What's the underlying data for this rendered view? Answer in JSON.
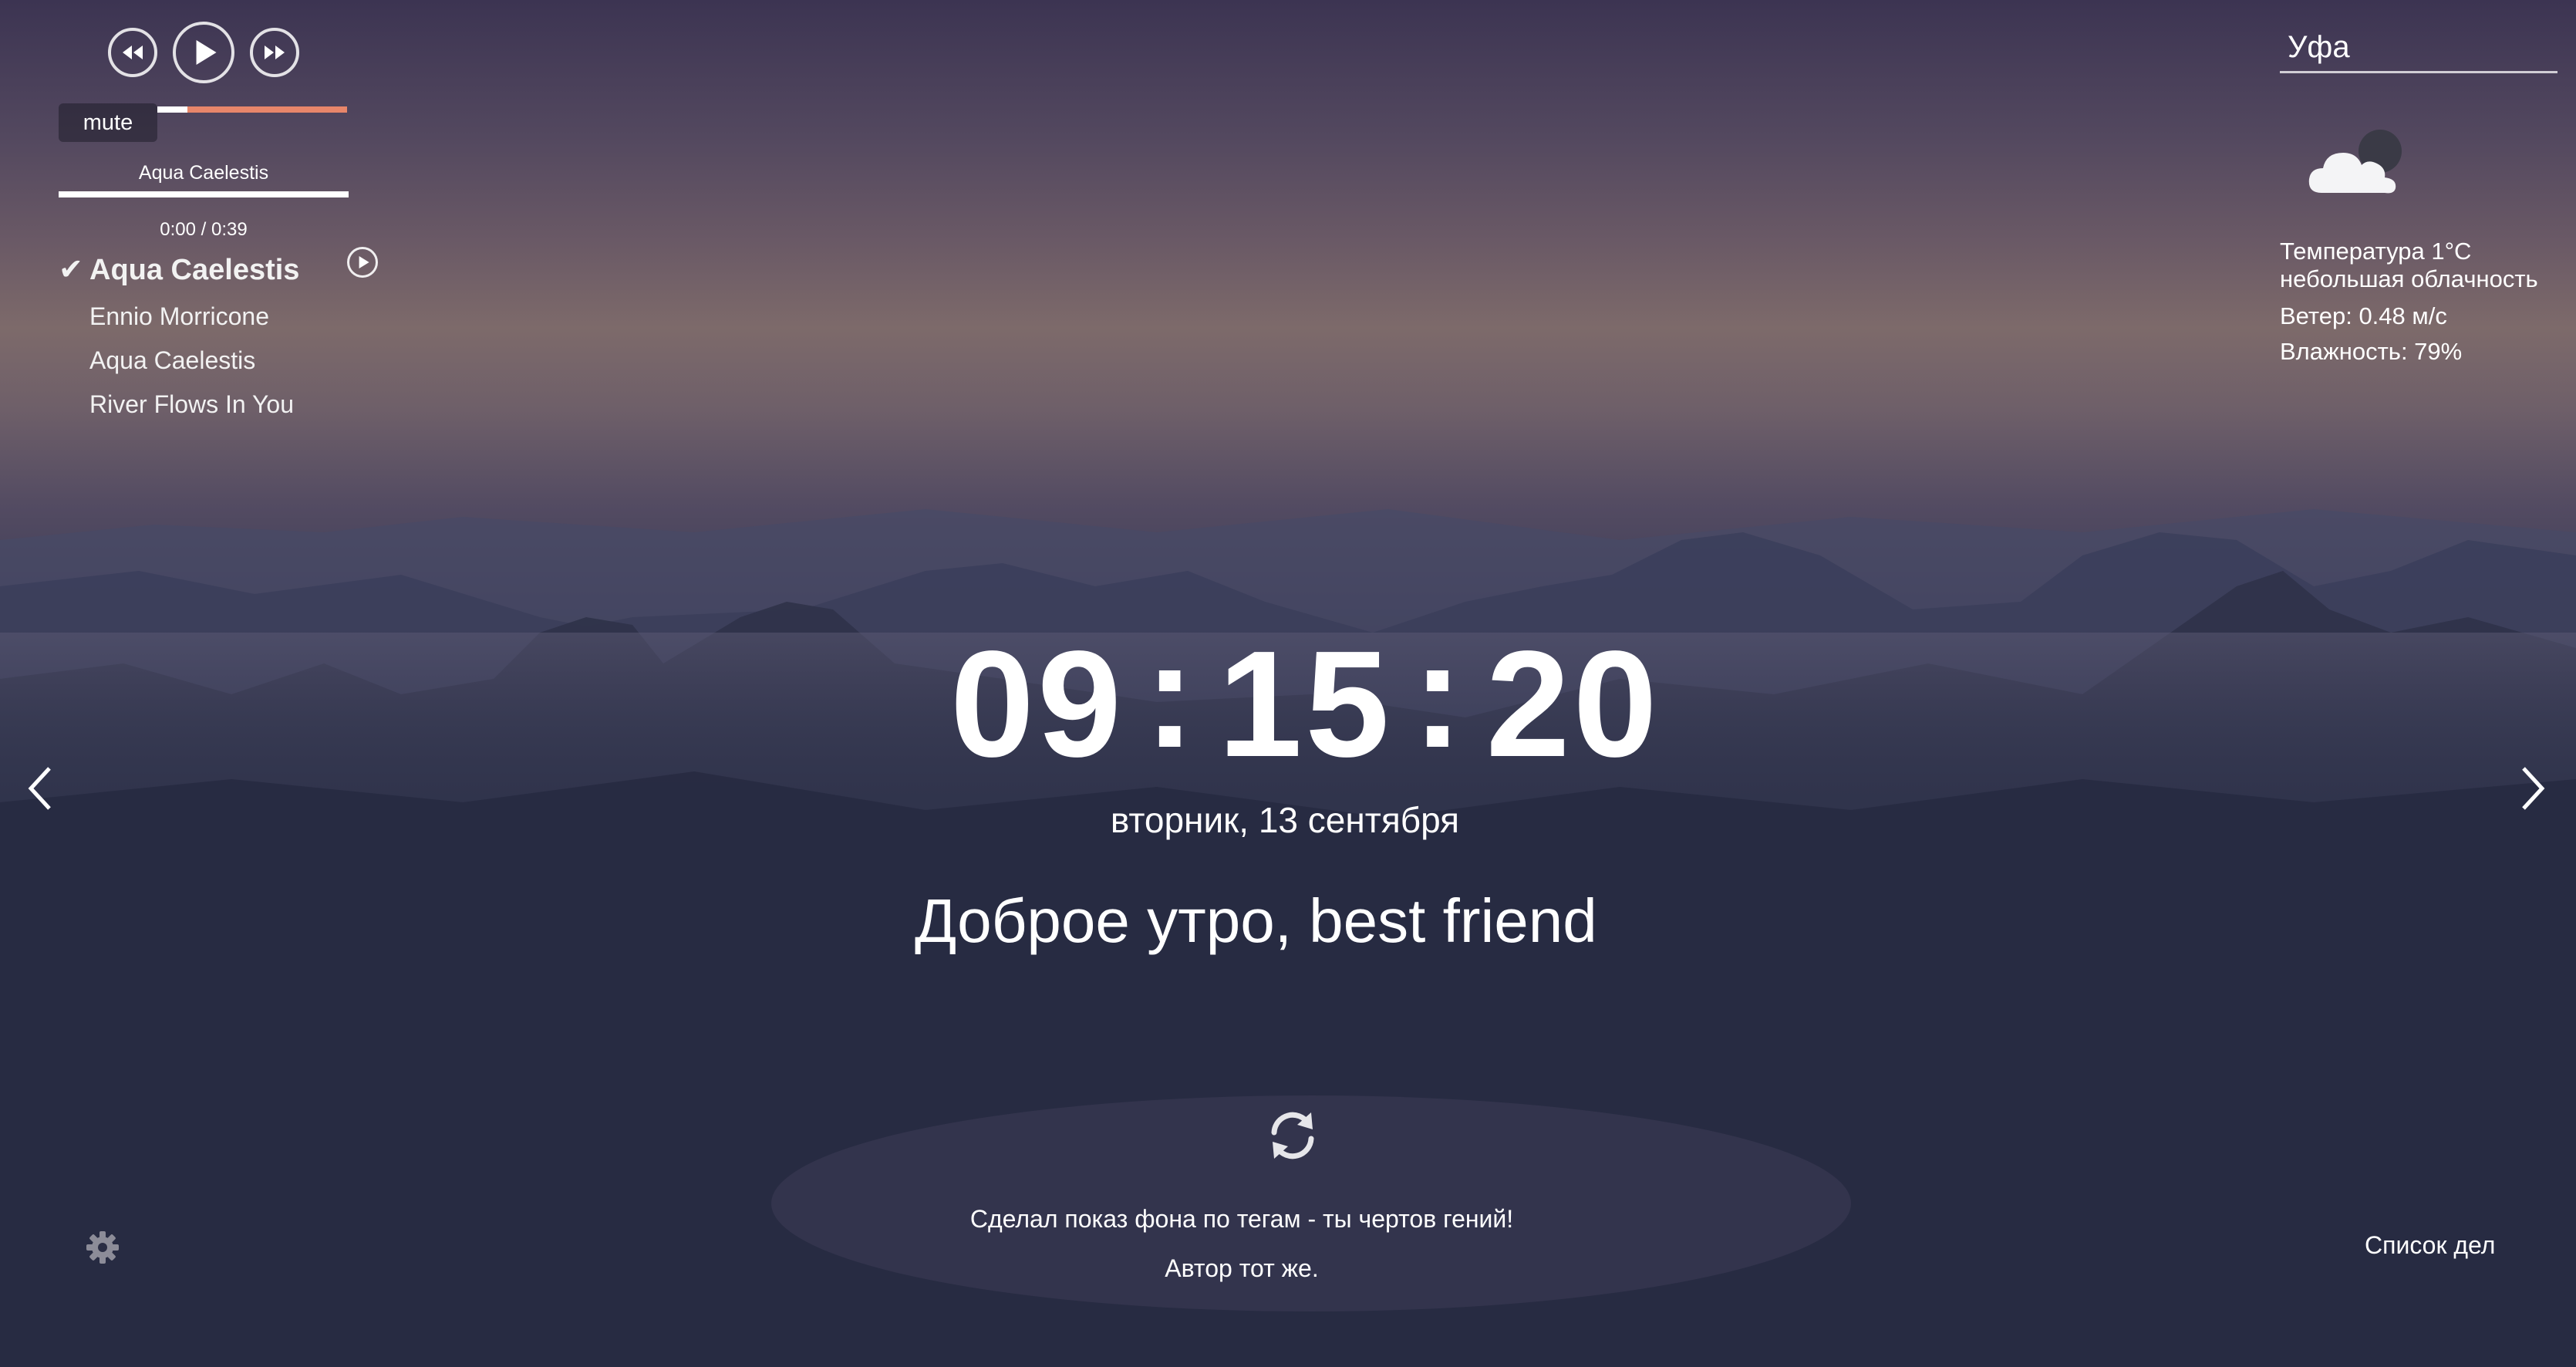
{
  "player": {
    "mute_label": "mute",
    "volume_level": 0.16,
    "current_track": "Aqua Caelestis",
    "time": "0:00 / 0:39",
    "progress": 1.0
  },
  "playlist": {
    "items": [
      {
        "label": "Aqua Caelestis",
        "active": true
      },
      {
        "label": "Ennio Morricone",
        "active": false
      },
      {
        "label": "Aqua Caelestis",
        "active": false
      },
      {
        "label": "River Flows In You",
        "active": false
      }
    ],
    "check_mark": "✔"
  },
  "weather": {
    "city": "Уфа",
    "temperature": "Температура 1°C",
    "description": "небольшая облачность",
    "wind": "Ветер: 0.48 м/с",
    "humidity": "Влажность: 79%",
    "icon": "partly-cloudy-night-icon"
  },
  "clock": {
    "time": "09:15:20",
    "date": "вторник, 13 сентября"
  },
  "greeting": "Доброе утро, best friend",
  "quote": {
    "text": "Сделал показ фона по тегам - ты чертов гений!",
    "author": "Автор тот же."
  },
  "todo_label": "Список дел",
  "colors": {
    "volume_track": "#e8866a",
    "text": "#ffffff"
  }
}
